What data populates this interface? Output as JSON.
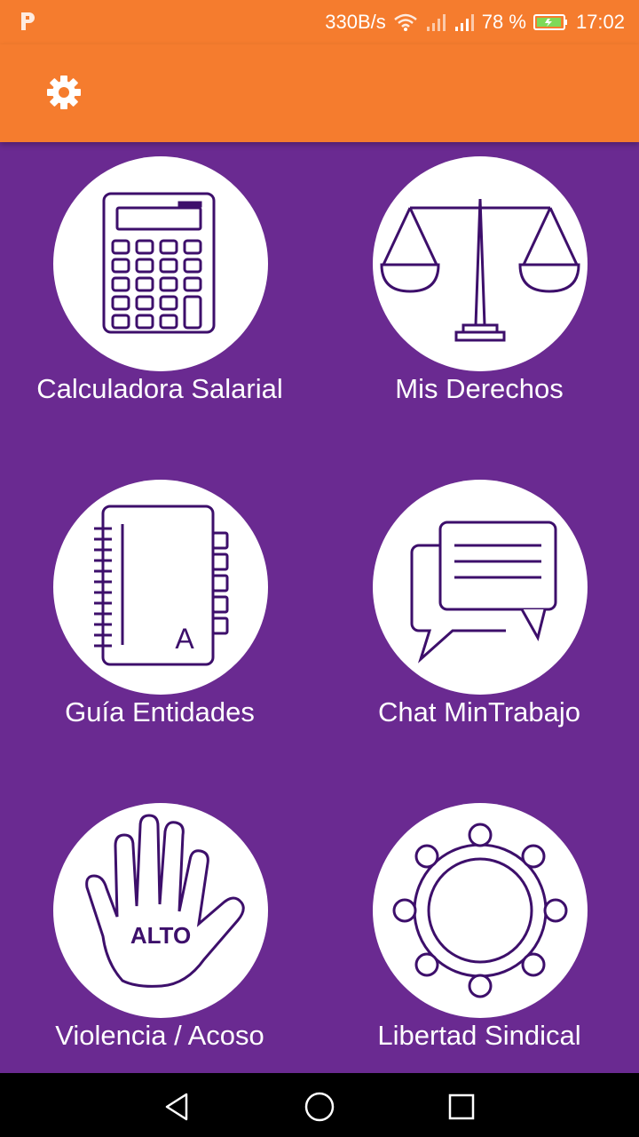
{
  "status_bar": {
    "network_speed": "330B/s",
    "battery_percent": "78 %",
    "time": "17:02",
    "icons": [
      "app-notification-icon",
      "wifi-icon",
      "signal-icon",
      "signal-icon",
      "battery-charging-icon"
    ]
  },
  "app_bar": {
    "settings_icon": "gear-icon",
    "color": "#F57C2E"
  },
  "theme": {
    "background": "#6A2A91",
    "icon_stroke": "#3D0F6B"
  },
  "menu": {
    "items": [
      {
        "label": "Calculadora Salarial",
        "icon": "calculator-icon"
      },
      {
        "label": "Mis Derechos",
        "icon": "scales-of-justice-icon"
      },
      {
        "label": "Guía Entidades",
        "icon": "address-book-icon",
        "icon_letter": "A"
      },
      {
        "label": "Chat MinTrabajo",
        "icon": "chat-bubbles-icon"
      },
      {
        "label": "Violencia / Acoso",
        "icon": "stop-hand-icon",
        "icon_text": "ALTO"
      },
      {
        "label": "Libertad Sindical",
        "icon": "round-table-icon"
      }
    ]
  },
  "nav_bar": {
    "buttons": [
      "back-icon",
      "home-icon",
      "recents-icon"
    ]
  }
}
